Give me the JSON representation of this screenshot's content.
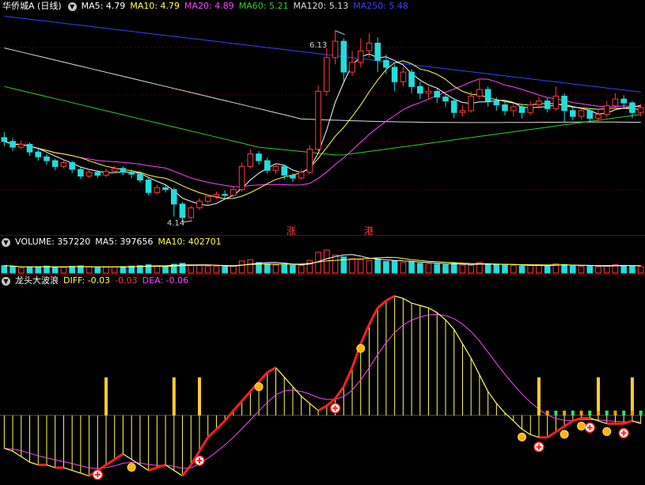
{
  "main_header": {
    "title": "华侨城A (日线)",
    "ma5": "MA5: 4.79",
    "ma10": "MA10: 4.79",
    "ma20": "MA20: 4.89",
    "ma60": "MA60: 5.21",
    "ma120": "MA120: 5.13",
    "ma250": "MA250: 5.48"
  },
  "annotations": {
    "high": "6.13",
    "low": "4.14",
    "tag_zhang": "涨",
    "tag_gang": "港"
  },
  "volume_header": {
    "label": "VOLUME: 357220",
    "ma5": "MA5: 397656",
    "ma10": "MA10: 402701"
  },
  "indicator_header": {
    "name": "龙头大波浪",
    "diff": "DIFF: -0.03",
    "val": "-0.03",
    "dea": "DEA: -0.06"
  },
  "colors": {
    "bg": "#000000",
    "ma5": "#ffffff",
    "ma10": "#ffff55",
    "ma20": "#ff44ff",
    "ma60": "#33cc33",
    "ma120": "#dddddd",
    "ma250": "#3344ff",
    "up": "#ff3b3b",
    "down": "#22dddd"
  },
  "chart_data": {
    "type": "candlestick",
    "price_high_marked": 6.13,
    "price_low_marked": 4.14,
    "candles": [
      [
        5.02,
        4.98,
        5.08,
        4.93
      ],
      [
        4.98,
        4.92,
        5.01,
        4.88
      ],
      [
        4.92,
        4.95,
        4.99,
        4.9
      ],
      [
        4.95,
        4.87,
        4.97,
        4.83
      ],
      [
        4.87,
        4.82,
        4.9,
        4.78
      ],
      [
        4.82,
        4.78,
        4.85,
        4.74
      ],
      [
        4.78,
        4.72,
        4.8,
        4.68
      ],
      [
        4.72,
        4.76,
        4.79,
        4.7
      ],
      [
        4.76,
        4.69,
        4.78,
        4.65
      ],
      [
        4.69,
        4.62,
        4.71,
        4.59
      ],
      [
        4.62,
        4.66,
        4.69,
        4.6
      ],
      [
        4.66,
        4.63,
        4.68,
        4.6
      ],
      [
        4.63,
        4.67,
        4.7,
        4.61
      ],
      [
        4.67,
        4.7,
        4.73,
        4.65
      ],
      [
        4.7,
        4.66,
        4.72,
        4.63
      ],
      [
        4.66,
        4.64,
        4.69,
        4.6
      ],
      [
        4.64,
        4.58,
        4.66,
        4.55
      ],
      [
        4.58,
        4.45,
        4.6,
        4.42
      ],
      [
        4.45,
        4.5,
        4.53,
        4.43
      ],
      [
        4.5,
        4.48,
        4.53,
        4.45
      ],
      [
        4.48,
        4.33,
        4.5,
        4.2
      ],
      [
        4.33,
        4.19,
        4.35,
        4.14
      ],
      [
        4.19,
        4.29,
        4.31,
        4.17
      ],
      [
        4.29,
        4.36,
        4.39,
        4.27
      ],
      [
        4.36,
        4.41,
        4.43,
        4.33
      ],
      [
        4.41,
        4.43,
        4.46,
        4.38
      ],
      [
        4.43,
        4.42,
        4.47,
        4.39
      ],
      [
        4.42,
        4.48,
        4.52,
        4.4
      ],
      [
        4.48,
        4.72,
        4.76,
        4.46
      ],
      [
        4.72,
        4.85,
        4.9,
        4.7
      ],
      [
        4.85,
        4.78,
        4.88,
        4.74
      ],
      [
        4.78,
        4.68,
        4.81,
        4.65
      ],
      [
        4.68,
        4.72,
        4.75,
        4.64
      ],
      [
        4.72,
        4.63,
        4.74,
        4.58
      ],
      [
        4.63,
        4.6,
        4.65,
        4.56
      ],
      [
        4.6,
        4.66,
        4.69,
        4.58
      ],
      [
        4.66,
        4.9,
        4.94,
        4.64
      ],
      [
        4.9,
        5.5,
        5.56,
        4.88
      ],
      [
        5.5,
        5.85,
        5.95,
        5.45
      ],
      [
        5.85,
        6.02,
        6.13,
        5.78
      ],
      [
        6.02,
        5.7,
        6.05,
        5.6
      ],
      [
        5.7,
        5.8,
        5.92,
        5.66
      ],
      [
        5.8,
        5.92,
        6.05,
        5.75
      ],
      [
        5.92,
        6.0,
        6.1,
        5.85
      ],
      [
        6.0,
        5.82,
        6.06,
        5.7
      ],
      [
        5.82,
        5.75,
        5.88,
        5.68
      ],
      [
        5.75,
        5.6,
        5.78,
        5.5
      ],
      [
        5.6,
        5.7,
        5.75,
        5.55
      ],
      [
        5.7,
        5.55,
        5.73,
        5.48
      ],
      [
        5.55,
        5.48,
        5.6,
        5.42
      ],
      [
        5.48,
        5.5,
        5.55,
        5.42
      ],
      [
        5.5,
        5.44,
        5.53,
        5.38
      ],
      [
        5.44,
        5.4,
        5.48,
        5.34
      ],
      [
        5.4,
        5.28,
        5.43,
        5.22
      ],
      [
        5.28,
        5.3,
        5.36,
        5.24
      ],
      [
        5.3,
        5.45,
        5.5,
        5.28
      ],
      [
        5.45,
        5.52,
        5.62,
        5.42
      ],
      [
        5.52,
        5.4,
        5.55,
        5.34
      ],
      [
        5.4,
        5.36,
        5.44,
        5.3
      ],
      [
        5.36,
        5.3,
        5.4,
        5.25
      ],
      [
        5.3,
        5.34,
        5.38,
        5.24
      ],
      [
        5.34,
        5.28,
        5.37,
        5.22
      ],
      [
        5.28,
        5.36,
        5.4,
        5.25
      ],
      [
        5.36,
        5.4,
        5.44,
        5.32
      ],
      [
        5.4,
        5.32,
        5.43,
        5.28
      ],
      [
        5.32,
        5.45,
        5.55,
        5.3
      ],
      [
        5.45,
        5.3,
        5.48,
        5.18
      ],
      [
        5.3,
        5.24,
        5.34,
        5.2
      ],
      [
        5.24,
        5.3,
        5.34,
        5.21
      ],
      [
        5.3,
        5.22,
        5.33,
        5.18
      ],
      [
        5.22,
        5.26,
        5.3,
        5.19
      ],
      [
        5.26,
        5.35,
        5.4,
        5.23
      ],
      [
        5.35,
        5.42,
        5.48,
        5.32
      ],
      [
        5.42,
        5.38,
        5.46,
        5.33
      ],
      [
        5.38,
        5.28,
        5.4,
        5.22
      ],
      [
        5.28,
        5.33,
        5.37,
        5.24
      ]
    ],
    "volume": [
      0.32,
      0.28,
      0.22,
      0.25,
      0.27,
      0.3,
      0.26,
      0.24,
      0.29,
      0.31,
      0.27,
      0.23,
      0.25,
      0.26,
      0.28,
      0.3,
      0.32,
      0.36,
      0.3,
      0.29,
      0.38,
      0.42,
      0.35,
      0.33,
      0.3,
      0.28,
      0.27,
      0.3,
      0.52,
      0.58,
      0.45,
      0.4,
      0.35,
      0.38,
      0.34,
      0.32,
      0.55,
      0.9,
      1.0,
      0.78,
      0.7,
      0.62,
      0.58,
      0.55,
      0.6,
      0.5,
      0.52,
      0.45,
      0.48,
      0.42,
      0.4,
      0.38,
      0.36,
      0.42,
      0.35,
      0.33,
      0.45,
      0.4,
      0.36,
      0.34,
      0.32,
      0.3,
      0.33,
      0.35,
      0.31,
      0.4,
      0.37,
      0.3,
      0.29,
      0.3,
      0.28,
      0.32,
      0.36,
      0.33,
      0.3,
      0.28
    ],
    "macd": [
      -0.12,
      -0.13,
      -0.15,
      -0.17,
      -0.18,
      -0.18,
      -0.19,
      -0.19,
      -0.2,
      -0.21,
      -0.22,
      -0.2,
      -0.18,
      -0.16,
      -0.14,
      -0.16,
      -0.18,
      -0.2,
      -0.19,
      -0.18,
      -0.2,
      -0.22,
      -0.18,
      -0.13,
      -0.08,
      -0.05,
      -0.02,
      0.02,
      0.06,
      0.1,
      0.14,
      0.18,
      0.2,
      0.16,
      0.12,
      0.08,
      0.05,
      0.02,
      0.04,
      0.07,
      0.12,
      0.2,
      0.3,
      0.38,
      0.45,
      0.48,
      0.5,
      0.49,
      0.47,
      0.46,
      0.45,
      0.43,
      0.4,
      0.36,
      0.3,
      0.24,
      0.17,
      0.1,
      0.05,
      0.01,
      -0.02,
      -0.05,
      -0.07,
      -0.08,
      -0.08,
      -0.06,
      -0.04,
      -0.02,
      -0.01,
      -0.01,
      -0.02,
      -0.03,
      -0.03,
      -0.03,
      -0.02,
      -0.03
    ]
  }
}
